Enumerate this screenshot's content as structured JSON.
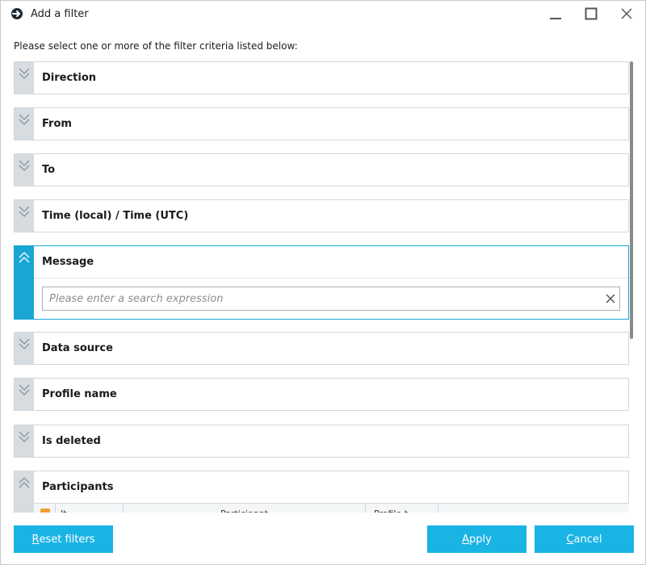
{
  "window": {
    "title": "Add a filter",
    "icons": {
      "app": "app-logo-icon",
      "minimize": "minimize-icon",
      "maximize": "maximize-icon",
      "close": "close-icon"
    }
  },
  "instruction": "Please select one or more of the filter criteria listed below:",
  "filters": [
    {
      "label": "Direction",
      "expanded": false
    },
    {
      "label": "From",
      "expanded": false
    },
    {
      "label": "To",
      "expanded": false
    },
    {
      "label": "Time (local) / Time (UTC)",
      "expanded": false
    },
    {
      "label": "Message",
      "expanded": true,
      "search_placeholder": "Please enter a search expression",
      "search_value": ""
    },
    {
      "label": "Data source",
      "expanded": false
    },
    {
      "label": "Profile name",
      "expanded": false
    },
    {
      "label": "Is deleted",
      "expanded": false
    },
    {
      "label": "Participants",
      "expanded": true
    }
  ],
  "participants_table": {
    "columns": [
      "It",
      "Participant",
      "Profile t",
      ""
    ]
  },
  "buttons": {
    "reset": {
      "mnemonic": "R",
      "rest": "eset filters"
    },
    "apply": {
      "mnemonic": "A",
      "rest": "pply"
    },
    "cancel": {
      "mnemonic": "C",
      "rest": "ancel"
    }
  },
  "colors": {
    "accent": "#1aa6d4",
    "button": "#1ab4e4",
    "collapsed_strip": "#d7dce0",
    "checkbox": "#f0a030"
  }
}
